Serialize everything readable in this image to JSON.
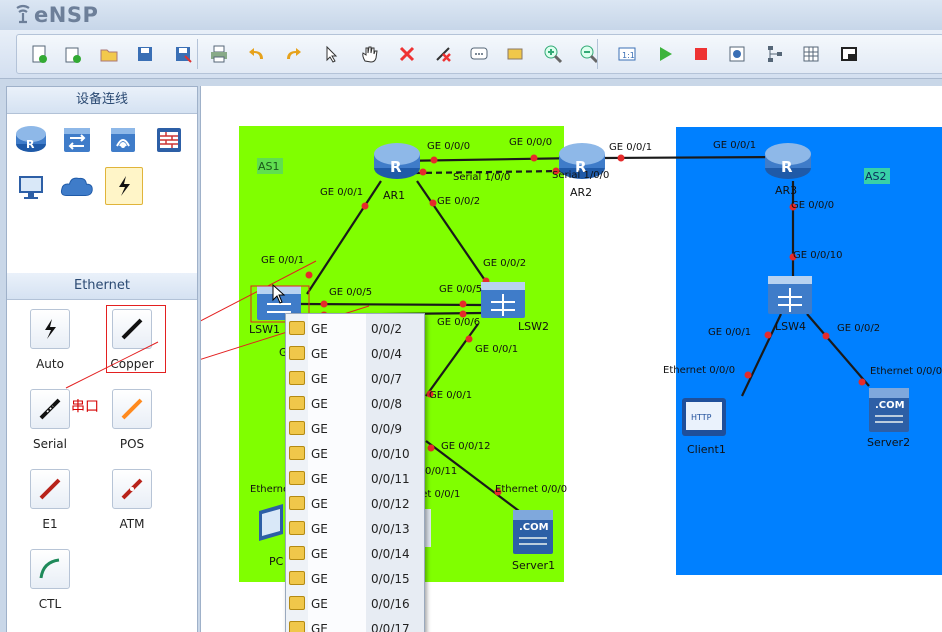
{
  "app": {
    "title": "eNSP"
  },
  "colors": {
    "as1": "#80ff00",
    "as2": "#0080ff",
    "link": "#1a1a1a",
    "port_dot": "#e52b2b",
    "annotation": "#e32020"
  },
  "toolbar": {
    "buttons": [
      "new-topology-icon",
      "new-lab-icon",
      "open-icon",
      "save-icon",
      "save-as-icon",
      "print-icon",
      "undo-icon",
      "redo-icon",
      "select-icon",
      "pan-hand-icon",
      "delete-icon",
      "delete-link-icon",
      "text-note-icon",
      "rectangle-icon",
      "zoom-in-icon",
      "zoom-out-icon",
      "fit-view-icon",
      "start-icon",
      "stop-icon",
      "capture-icon",
      "topology-icon",
      "grid-icon",
      "screenshot-icon"
    ]
  },
  "sidebar": {
    "devices_title": "设备连线",
    "device_icons": [
      "router-icon",
      "switch-icon",
      "wireless-icon",
      "firewall-icon",
      "pc-icon",
      "cloud-icon",
      "link-icon"
    ],
    "ethernet_title": "Ethernet",
    "links": [
      {
        "label": "Auto",
        "icon": "auto-link-icon",
        "color": "#111111"
      },
      {
        "label": "Copper",
        "icon": "copper-link-icon",
        "color": "#111111"
      },
      {
        "label": "Serial",
        "icon": "serial-link-icon",
        "color": "#111111"
      },
      {
        "label": "POS",
        "icon": "pos-link-icon",
        "color": "#ff8a1e"
      },
      {
        "label": "E1",
        "icon": "e1-link-icon",
        "color": "#b8231a"
      },
      {
        "label": "ATM",
        "icon": "atm-link-icon",
        "color": "#b8231a"
      },
      {
        "label": "CTL",
        "icon": "ctl-link-icon",
        "color": "#1f8a5a"
      }
    ],
    "hint": "串口"
  },
  "topology": {
    "as1_label": "AS1",
    "as2_label": "AS2",
    "devices": {
      "ar1": "AR1",
      "ar2": "AR2",
      "ar3": "AR3",
      "lsw1": "LSW1",
      "lsw2": "LSW2",
      "lsw4": "LSW4",
      "client1": "Client1",
      "server1": "Server1",
      "server2": "Server2",
      "pc_partial": "PC",
      "lsw1_partial": "G"
    },
    "ports": {
      "ar1_ge000": "GE 0/0/0",
      "ar2_ge000": "GE 0/0/0",
      "ar2_ge001": "GE 0/0/1",
      "ar3_ge001": "GE 0/0/1",
      "ar1_serial": "Serial 1/0/0",
      "ar2_serial": "Serial 1/0/0",
      "ar1_ge001": "GE 0/0/1",
      "ar1_ge002": "GE 0/0/2",
      "lsw1_ge001": "GE 0/0/1",
      "lsw1_ge005": "GE 0/0/5",
      "lsw2_ge005": "GE 0/0/5",
      "lsw2_ge002": "GE 0/0/2",
      "lsw2_ge006": "GE 0/0/6",
      "lsw2_ge001": "GE 0/0/1",
      "sw3_ge001": "GE 0/0/1",
      "sw3_ge0012": "GE 0/0/12",
      "sw3_ge0011": "0/0/11",
      "server1_eth": "Ethernet 0/0/0",
      "pc_eth_partial": "Etherne",
      "mid_eth_partial": "rnet 0/0/1",
      "ar3_ge000": "GE 0/0/0",
      "lsw4_ge0010": "GE 0/0/10",
      "lsw4_ge001": "GE 0/0/1",
      "lsw4_ge002": "GE 0/0/2",
      "client1_eth": "Ethernet 0/0/0",
      "server2_eth": "Ethernet 0/0/0"
    }
  },
  "port_menu": {
    "items": [
      {
        "type": "GE",
        "port": "0/0/2"
      },
      {
        "type": "GE",
        "port": "0/0/4"
      },
      {
        "type": "GE",
        "port": "0/0/7"
      },
      {
        "type": "GE",
        "port": "0/0/8"
      },
      {
        "type": "GE",
        "port": "0/0/9"
      },
      {
        "type": "GE",
        "port": "0/0/10"
      },
      {
        "type": "GE",
        "port": "0/0/11"
      },
      {
        "type": "GE",
        "port": "0/0/12"
      },
      {
        "type": "GE",
        "port": "0/0/13"
      },
      {
        "type": "GE",
        "port": "0/0/14"
      },
      {
        "type": "GE",
        "port": "0/0/15"
      },
      {
        "type": "GE",
        "port": "0/0/16"
      },
      {
        "type": "GE",
        "port": "0/0/17"
      }
    ]
  }
}
